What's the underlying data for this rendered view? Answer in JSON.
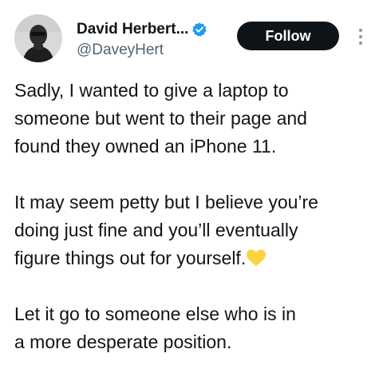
{
  "author": {
    "display_name": "David Herbert...",
    "handle": "@DaveyHert",
    "verified": true
  },
  "actions": {
    "follow_label": "Follow",
    "more_icon": "vertical-dots-icon"
  },
  "tweet": {
    "paragraphs": [
      "Sadly, I wanted to give a laptop to\nsomeone but went to their page and\nfound they owned an iPhone 11.",
      "It may seem petty but I believe you’re\ndoing just fine and you’ll eventually\nfigure things out for yourself.",
      " Let it go to someone else who is in\na more desperate position."
    ],
    "emoji": "yellow-heart-icon"
  },
  "colors": {
    "text": "#0f1419",
    "muted": "#536471",
    "verified_blue": "#1d9bf0",
    "heart_yellow": "#ffd23f",
    "button_bg": "#0f1419"
  }
}
